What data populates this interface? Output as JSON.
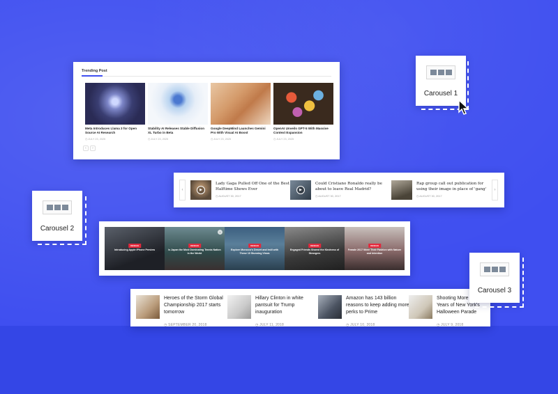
{
  "carousel1": {
    "heading": "Trending Post",
    "posts": [
      {
        "title": "Meta Introduces Llama 3 for Open Source AI Research",
        "date": "JULY 23, 2025"
      },
      {
        "title": "Stability AI Releases Stable Diffusion XL Turbo in Beta",
        "date": "JULY 23, 2025"
      },
      {
        "title": "Google DeepMind Launches Gemini Pro With Visual AI Boost",
        "date": "JULY 23, 2025"
      },
      {
        "title": "OpenAI Unveils GPT-5 With Massive Context Expansion",
        "date": "JULY 23, 2025"
      }
    ],
    "nav_prev": "‹",
    "nav_next": "›"
  },
  "carousel2": {
    "prev": "‹",
    "next": "›",
    "items": [
      {
        "title": "Lady Gaga Pulled Off One of the Best Halftime Shows Ever",
        "date": "AUGUST 30, 2017",
        "play": "▶"
      },
      {
        "title": "Could Cristiano Ronaldo really be about to leave Real Madrid?",
        "date": "AUGUST 30, 2017",
        "play": "▶"
      },
      {
        "title": "Rap group call out publication for using their image in place of 'gang'",
        "date": "AUGUST 30, 2017",
        "play": ""
      }
    ]
  },
  "carousel3": {
    "badge": "DESIGN",
    "slides": [
      {
        "caption": "Introducing Apple iPhone Preview"
      },
      {
        "caption": "Is Japan the Most Dominating Tennis Nation in the World"
      },
      {
        "caption": "Explore Morocco's Desert and Imlil with These 10 Stunning Views"
      },
      {
        "caption": "Engaged Friends Shared the Kindness of Strangers"
      },
      {
        "caption": "Female 2017 Wore Their Fashion with Nature and Intention"
      }
    ],
    "nav_icon": "›"
  },
  "carousel4": {
    "items": [
      {
        "title": "Heroes of the Storm Global Championship 2017 starts tomorrow",
        "date": "SEPTEMBER 20, 2018"
      },
      {
        "title": "Hillary Clinton in white pantsuit for Trump inauguration",
        "date": "JULY 11, 2018"
      },
      {
        "title": "Amazon has 143 billion reasons to keep adding more perks to Prime",
        "date": "JULY 10, 2018"
      },
      {
        "title": "Shooting More than 40 Years of New York's Halloween Parade",
        "date": "JULY 9, 2018"
      }
    ]
  },
  "labels": {
    "carousel1": "Carousel 1",
    "carousel2": "Carousel 2",
    "carousel3": "Carousel 3"
  },
  "colors": {
    "background": "#3f4ff0",
    "accent_red": "#e4283c",
    "card": "#ffffff"
  },
  "icons": {
    "clock": "clock-icon",
    "play": "play-icon",
    "cursor": "mouse-cursor-icon"
  }
}
